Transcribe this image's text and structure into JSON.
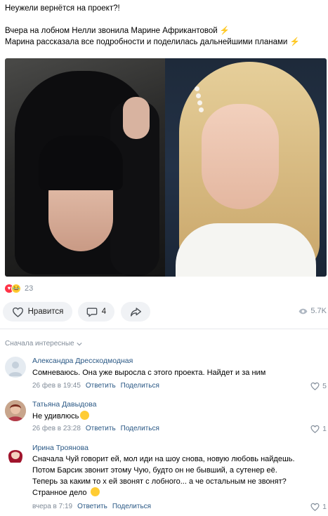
{
  "post": {
    "line1": "Неужели вернётся на проект?!",
    "line2": "Вчера на лобном Нелли звонила Марине Африкантовой",
    "line3": "Марина рассказала все подробности и поделилась дальнейшими планами",
    "bolt": "⚡"
  },
  "reactions": {
    "count": "23",
    "heart": "♥",
    "laugh": "😂"
  },
  "actions": {
    "like_label": "Нравится",
    "comment_count": "4",
    "views": "5.7K"
  },
  "comments_sort": "Сначала интересные",
  "comments": [
    {
      "author": "Александра Дресскодмодная",
      "text": [
        "Сомневаюсь. Она уже выросла с этого проекта. Найдет и за ним"
      ],
      "date": "26 фев в 19:45",
      "reply": "Ответить",
      "share": "Поделиться",
      "likes": "5"
    },
    {
      "author": "Татьяна Давыдова",
      "text": [
        "Не удивлюсь"
      ],
      "date": "26 фев в 23:28",
      "reply": "Ответить",
      "share": "Поделиться",
      "likes": "1"
    },
    {
      "author": "Ирина Троянова",
      "text": [
        "Сначала Чуй говорит ей, мол иди на шоу снова, новую любовь найдешь.",
        "Потом Барсик звонит этому Чую, будто он не бывший, а сутенер её.",
        "Теперь за каким то х ей звонят с лобного... а че остальным не звонят?",
        "Странное дело"
      ],
      "date": "вчера в 7:19",
      "reply": "Ответить",
      "share": "Поделиться",
      "likes": "1"
    }
  ]
}
